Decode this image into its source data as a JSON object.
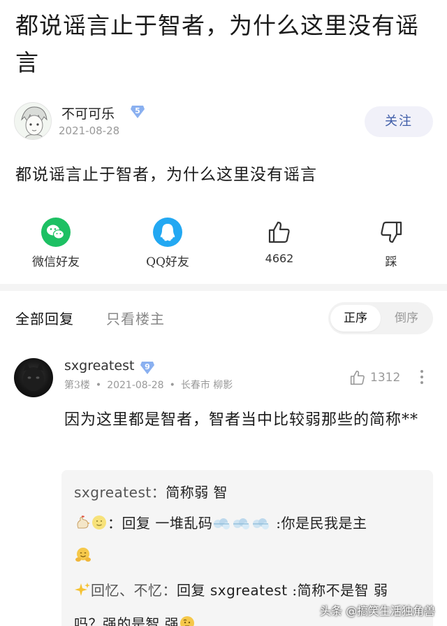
{
  "article": {
    "title": "都说谣言止于智者，为什么这里没有谣言",
    "body": "都说谣言止于智者，为什么这里没有谣言"
  },
  "author": {
    "name": "不可可乐",
    "level": "5",
    "date": "2021-08-28",
    "follow_label": "关注"
  },
  "share": {
    "wechat_label": "微信好友",
    "qq_label": "QQ好友",
    "like_count": "4662",
    "dislike_label": "踩"
  },
  "tabs": {
    "all_label": "全部回复",
    "owner_label": "只看楼主"
  },
  "sort": {
    "asc_label": "正序",
    "desc_label": "倒序"
  },
  "comment": {
    "user": "sxgreatest",
    "level": "9",
    "floor": "第3楼",
    "date": "2021-08-28",
    "location": "长春市 柳影",
    "like_count": "1312",
    "text": "因为这里都是智者，智者当中比较弱那些的简称**"
  },
  "replies": {
    "r1_user": "sxgreatest：",
    "r1_text": "简称弱 智",
    "r2_prefix": "：回复 一堆乱码",
    "r2_text": " :你是民我是主",
    "r3_user": "回忆、不忆：",
    "r3_text_a": "回复 ",
    "r3_target": "sxgreatest",
    "r3_text_b": " :简称不是智 弱",
    "r3_text_c": "吗？强的是智 强"
  },
  "watermark": "头条 @搞笑生活独角兽",
  "colors": {
    "accent_blue": "#3f5da8",
    "wechat_green": "#1dc063",
    "qq_blue": "#23a8f2",
    "badge_blue": "#8ab0f0"
  }
}
